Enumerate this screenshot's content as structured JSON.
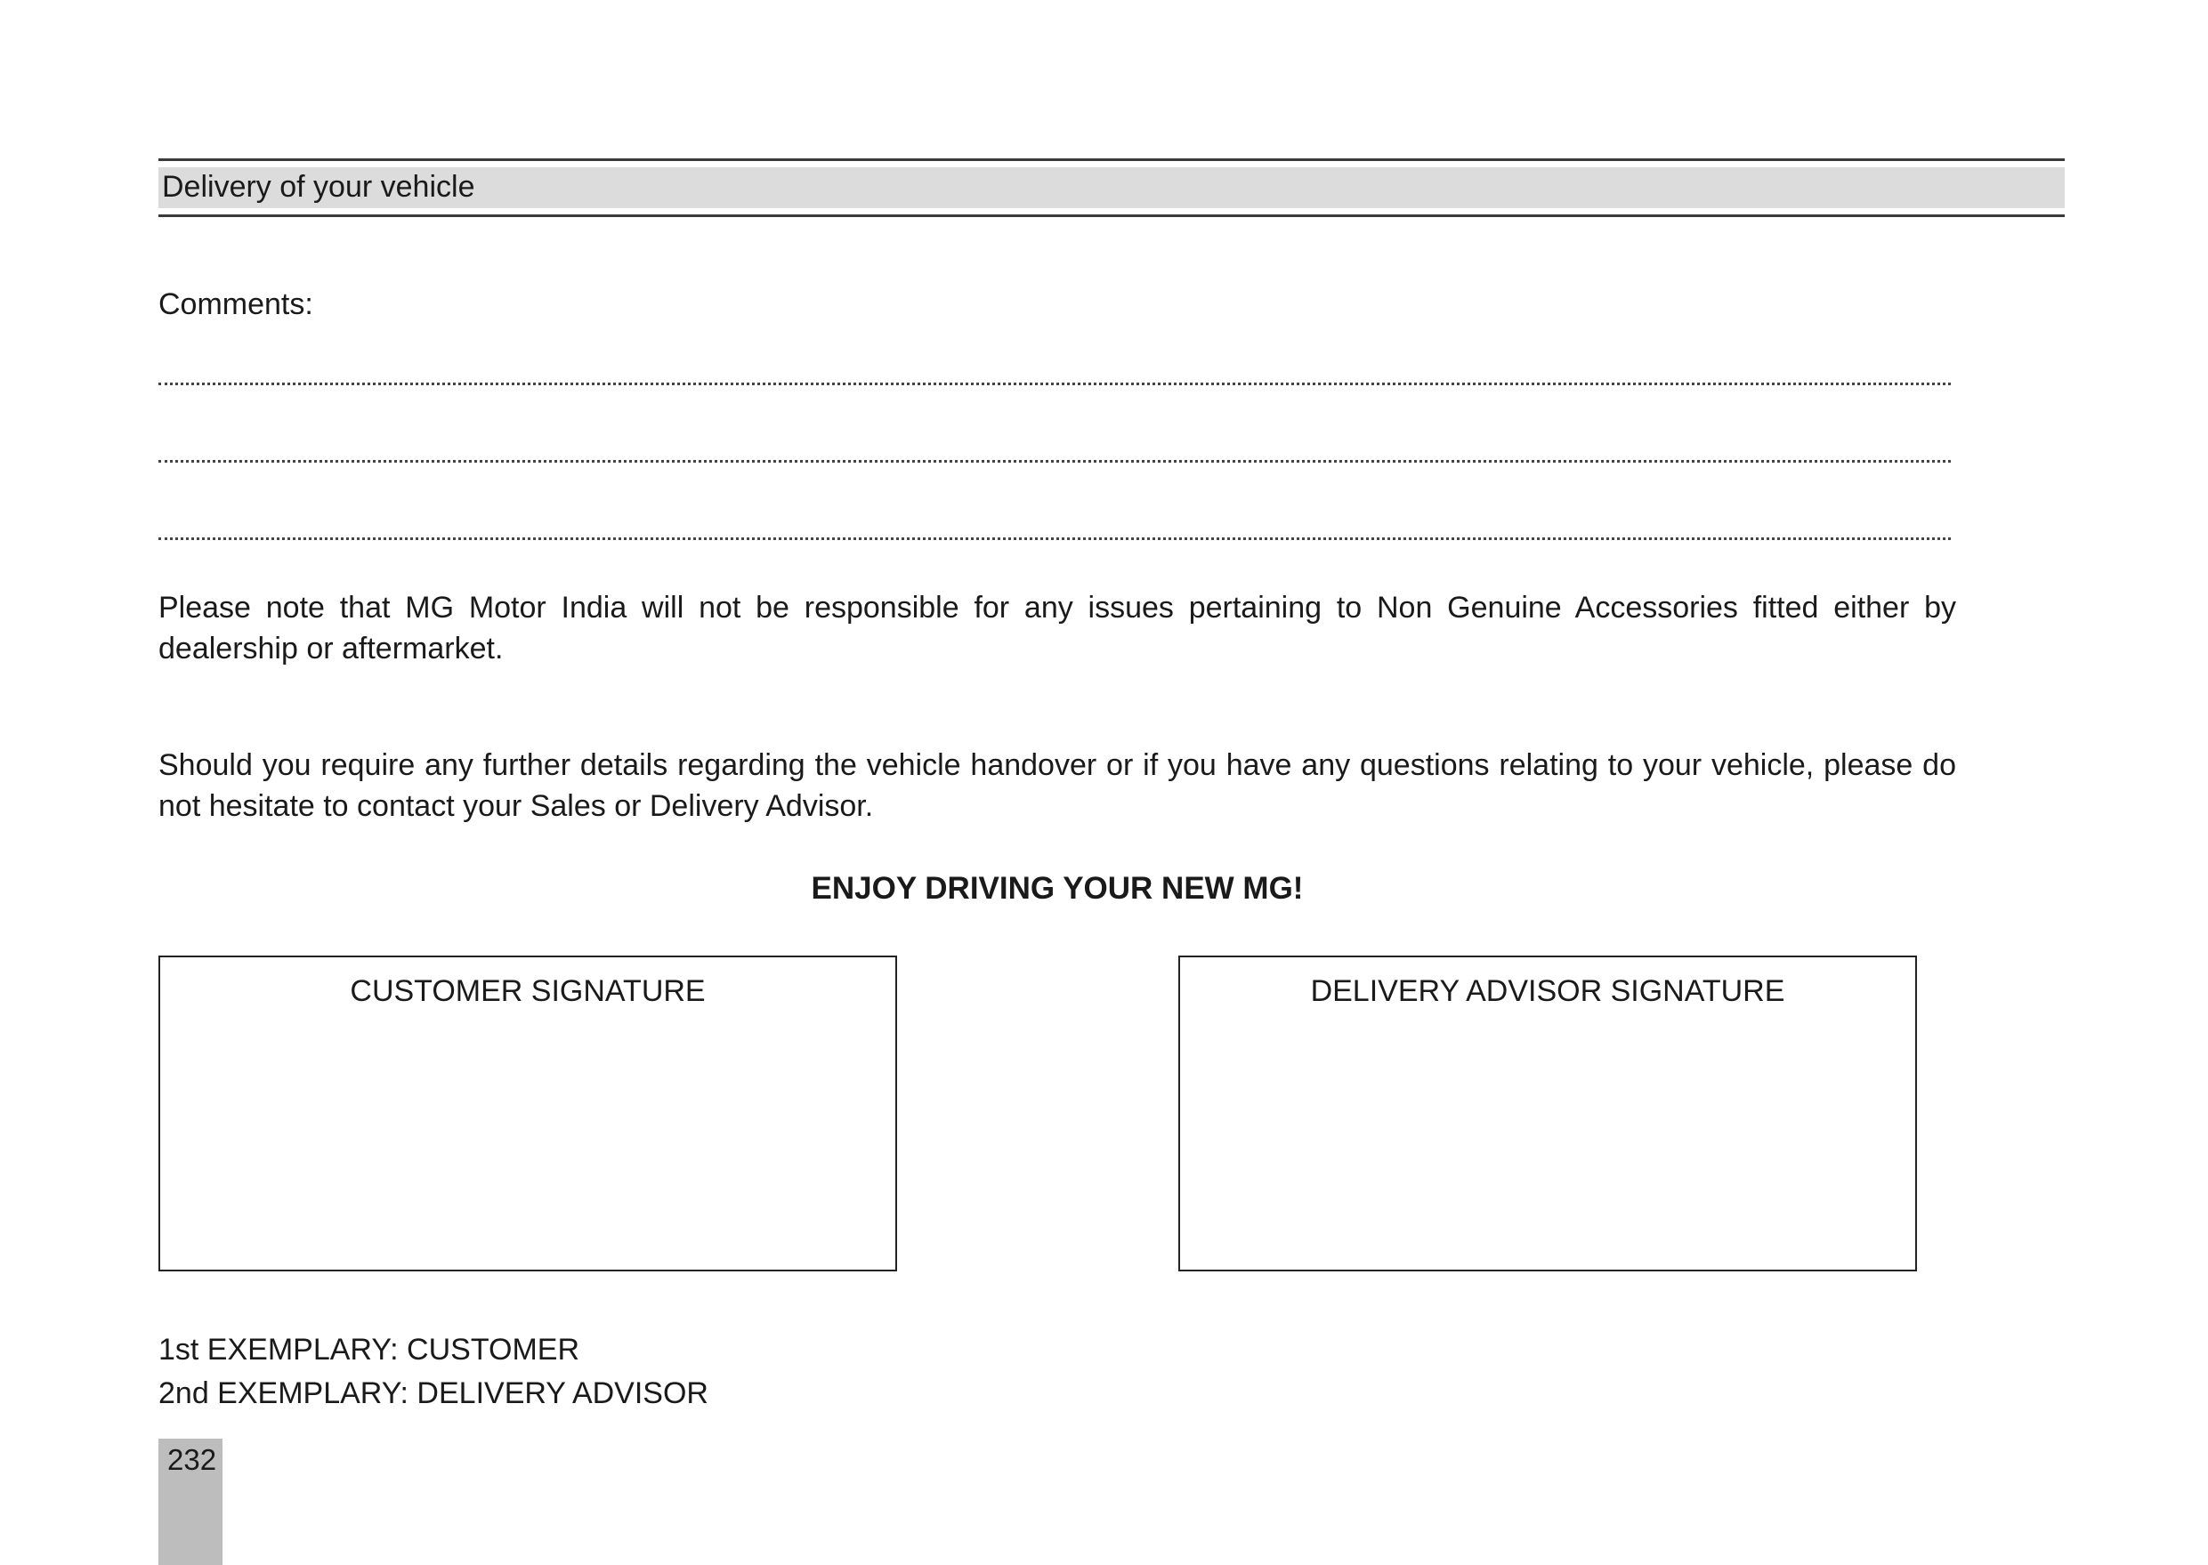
{
  "header": {
    "title": "Delivery of your vehicle"
  },
  "comments": {
    "label": "Comments:"
  },
  "notes": {
    "accessories": "Please note that MG Motor India will not be responsible for any issues pertaining to Non Genuine Accessories fitted either by dealership or aftermarket.",
    "contact": "Should you require any further details regarding the vehicle handover or if you have any questions relating to your vehicle, please do not hesitate to contact your Sales or Delivery Advisor."
  },
  "closing": "ENJOY DRIVING YOUR NEW MG!",
  "signatures": {
    "customer": "CUSTOMER SIGNATURE",
    "advisor": "DELIVERY ADVISOR SIGNATURE"
  },
  "exemplary": {
    "first": "1st EXEMPLARY: CUSTOMER",
    "second": "2nd EXEMPLARY: DELIVERY ADVISOR"
  },
  "page_number": "232"
}
